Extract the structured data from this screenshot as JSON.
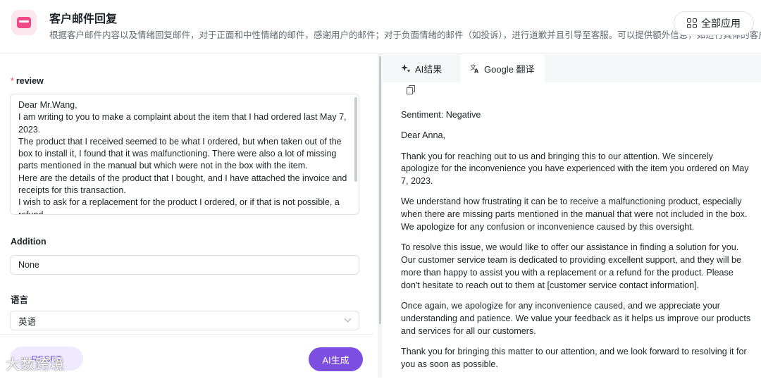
{
  "header": {
    "title": "客户邮件回复",
    "description": "根据客户邮件内容以及情绪回复邮件，对于正面和中性情绪的邮件，感谢用户的邮件；对于负面情绪的邮件（如投诉），进行道歉并且引导至客服。可以提供额外信息，如进行具体的客户权益回复",
    "all_apps_label": "全部应用"
  },
  "form": {
    "review_label": "review",
    "review_required_mark": "*",
    "review_text": "Dear Mr.Wang,\nI am writing to you to make a complaint about the item that I had ordered last May 7, 2023.\nThe product that I received seemed to be what I ordered, but when taken out of the box to install it, I found that it was malfunctioning. There were also a lot of missing parts mentioned in the manual but which were not in the box with the item.\nHere are the details of the product that I bought, and I have attached the invoice and receipts for this transaction.\nI wish to ask for a replacement for the product I ordered, or if that is not possible, a refund.",
    "addition_label": "Addition",
    "addition_value": "None",
    "language_label": "语言",
    "language_value": "英语",
    "reset_label": "RESET",
    "generate_label": "AI生成"
  },
  "watermark": "大数跨境",
  "tabs": [
    {
      "label": "AI结果",
      "icon": "sparkle-icon"
    },
    {
      "label": "Google 翻译",
      "icon": "translate-icon"
    }
  ],
  "result": {
    "paragraphs": [
      "Sentiment: Negative",
      "Dear Anna,",
      "Thank you for reaching out to us and bringing this to our attention. We sincerely apologize for the inconvenience you have experienced with the item you ordered on May 7, 2023.",
      "We understand how frustrating it can be to receive a malfunctioning product, especially when there are missing parts mentioned in the manual that were not included in the box. We apologize for any confusion or inconvenience caused by this oversight.",
      "To resolve this issue, we would like to offer our assistance in finding a solution for you. Our customer service team is dedicated to providing excellent support, and they will be more than happy to assist you with a replacement or a refund for the product. Please don't hesitate to reach out to them at [customer service contact information].",
      "Once again, we apologize for any inconvenience caused, and we appreciate your understanding and patience. We value your feedback as it helps us improve our products and services for all our customers.",
      "Thank you for bringing this matter to our attention, and we look forward to resolving it for you as soon as possible."
    ]
  },
  "colors": {
    "accent": "#7c4fe0",
    "logo": "#f04a86"
  }
}
